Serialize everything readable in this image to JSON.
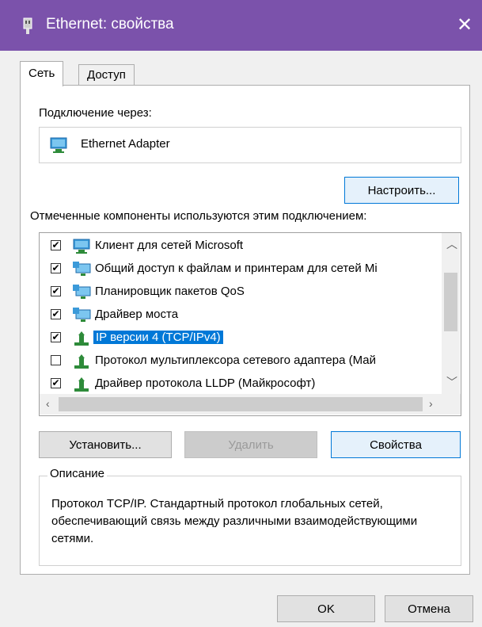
{
  "window": {
    "title": "Ethernet: свойства",
    "close_glyph": "✕",
    "accent": "#7b52ab"
  },
  "tabs": [
    {
      "label": "Сеть"
    },
    {
      "label": "Доступ"
    }
  ],
  "connect_via": {
    "label": "Подключение через:",
    "adapter": "Ethernet Adapter"
  },
  "buttons": {
    "configure": "Настроить...",
    "install": "Установить...",
    "uninstall": "Удалить",
    "properties": "Свойства",
    "ok": "OK",
    "cancel": "Отмена"
  },
  "components_label": "Отмеченные компоненты используются этим подключением:",
  "components": [
    {
      "label": "Клиент для сетей Microsoft",
      "checked": true,
      "icon": "network-client-icon"
    },
    {
      "label": "Общий доступ к файлам и принтерам для сетей Mi",
      "checked": true,
      "icon": "network-service-icon"
    },
    {
      "label": "Планировщик пакетов QoS",
      "checked": true,
      "icon": "network-service-icon"
    },
    {
      "label": "Драйвер моста",
      "checked": true,
      "icon": "network-service-icon"
    },
    {
      "label": "IP версии 4 (TCP/IPv4)",
      "checked": true,
      "icon": "protocol-icon",
      "selected": true
    },
    {
      "label": "Протокол мультиплексора сетевого адаптера (Май",
      "checked": false,
      "icon": "protocol-icon"
    },
    {
      "label": "Драйвер протокола LLDP (Майкрософт)",
      "checked": true,
      "icon": "protocol-icon"
    }
  ],
  "description": {
    "legend": "Описание",
    "text": "Протокол TCP/IP. Стандартный протокол глобальных сетей, обеспечивающий связь между различными взаимодействующими сетями."
  }
}
